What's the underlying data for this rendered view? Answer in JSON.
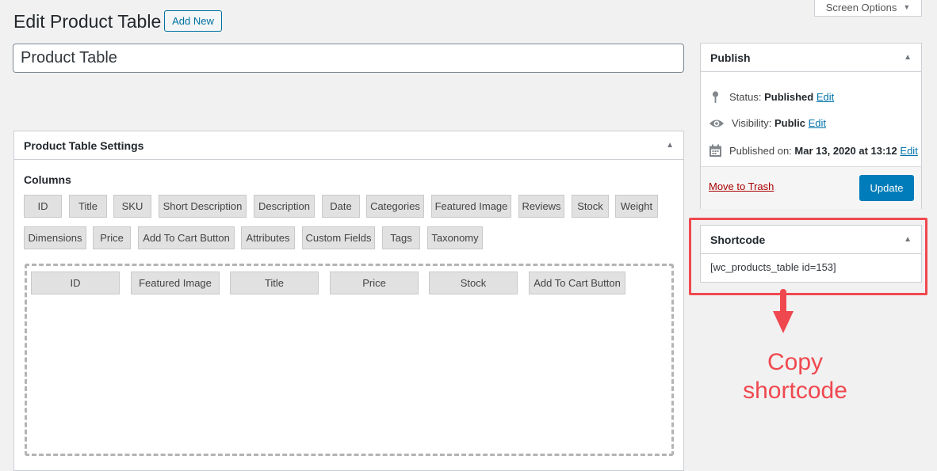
{
  "header": {
    "screen_options": "Screen Options",
    "page_title": "Edit Product Table",
    "add_new": "Add New"
  },
  "title_field": {
    "value": "Product Table"
  },
  "settings": {
    "heading": "Product Table Settings",
    "columns_label": "Columns",
    "available_columns": [
      "ID",
      "Title",
      "SKU",
      "Short Description",
      "Description",
      "Date",
      "Categories",
      "Featured Image",
      "Reviews",
      "Stock",
      "Weight",
      "Dimensions",
      "Price",
      "Add To Cart Button",
      "Attributes",
      "Custom Fields",
      "Tags",
      "Taxonomy"
    ],
    "selected_columns": [
      "ID",
      "Featured Image",
      "Title",
      "Price",
      "Stock",
      "Add To Cart Button"
    ]
  },
  "publish": {
    "heading": "Publish",
    "status_label": "Status:",
    "status_value": "Published",
    "visibility_label": "Visibility:",
    "visibility_value": "Public",
    "published_label": "Published on:",
    "published_value": "Mar 13, 2020 at 13:12",
    "edit_link": "Edit",
    "trash_link": "Move to Trash",
    "update_button": "Update"
  },
  "shortcode": {
    "heading": "Shortcode",
    "value": "[wc_products_table id=153]"
  },
  "annotation": {
    "line1": "Copy",
    "line2": "shortcode",
    "color": "#f0484f"
  },
  "icons": [
    "chevron-down-icon",
    "collapse-arrow-icon",
    "pin-icon",
    "eye-icon",
    "calendar-icon",
    "down-arrow-icon"
  ]
}
